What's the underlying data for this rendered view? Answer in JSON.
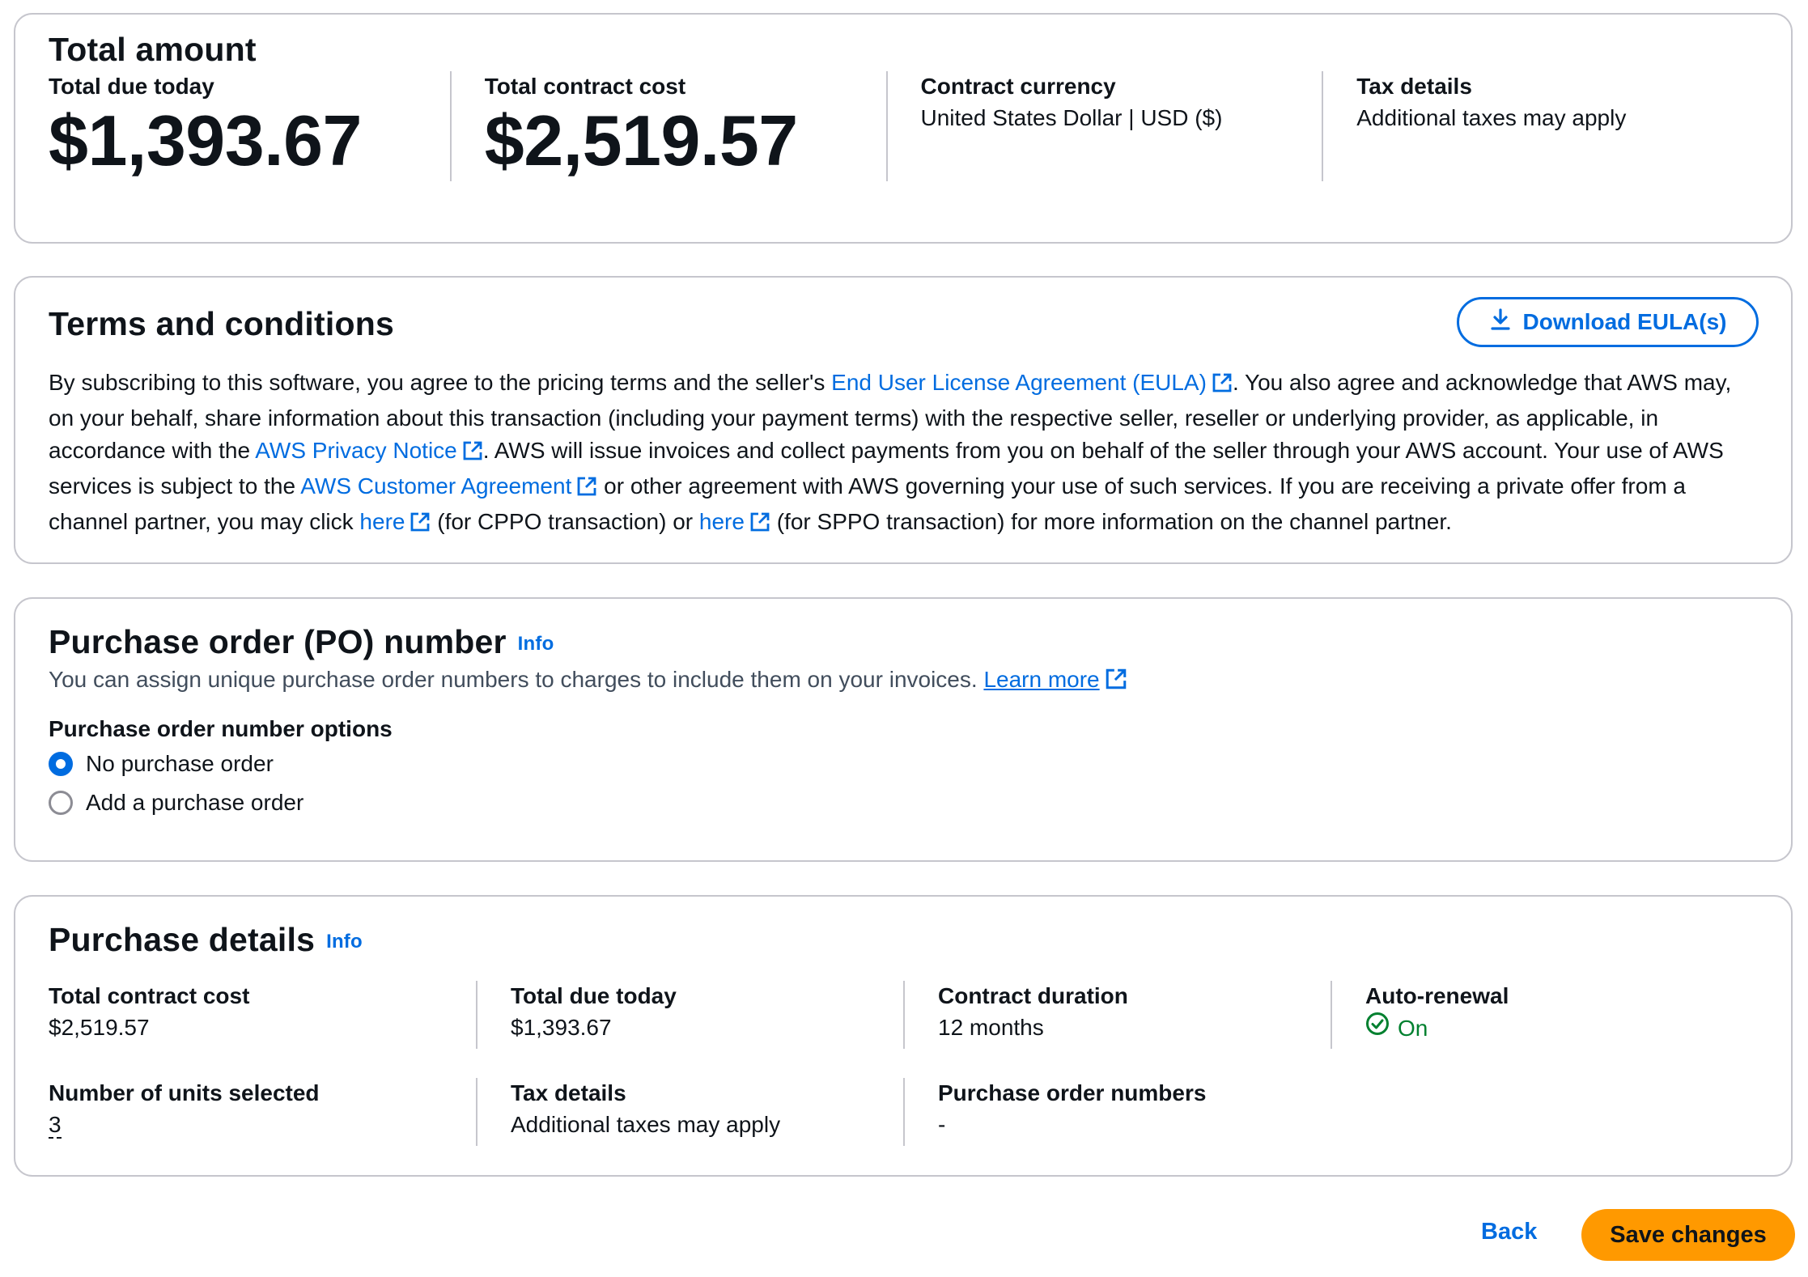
{
  "total_amount": {
    "title": "Total amount",
    "due_today_label": "Total due today",
    "due_today_value": "$1,393.67",
    "contract_cost_label": "Total contract cost",
    "contract_cost_value": "$2,519.57",
    "currency_label": "Contract currency",
    "currency_value": "United States Dollar | USD ($)",
    "tax_label": "Tax details",
    "tax_value": "Additional taxes may apply"
  },
  "terms": {
    "title": "Terms and conditions",
    "download_label": "Download EULA(s)",
    "text_1": "By subscribing to this software, you agree to the pricing terms and the seller's ",
    "link_eula": "End User License Agreement (EULA)",
    "text_2": ". You also agree and acknowledge that AWS may, on your behalf, share information about this transaction (including your payment terms) with the respective seller, reseller or underlying provider, as applicable, in accordance with the ",
    "link_privacy": "AWS Privacy Notice",
    "text_3": ". AWS will issue invoices and collect payments from you on behalf of the seller through your AWS account. Your use of AWS services is subject to the ",
    "link_customer": "AWS Customer Agreement",
    "text_4": " or other agreement with AWS governing your use of such services. If you are receiving a private offer from a channel partner, you may click ",
    "link_here_1": "here",
    "text_5": " (for CPPO transaction) or ",
    "link_here_2": "here",
    "text_6": " (for SPPO transaction) for more information on the channel partner."
  },
  "po": {
    "title": "Purchase order (PO) number",
    "info_label": "Info",
    "description": "You can assign unique purchase order numbers to charges to include them on your invoices. ",
    "learn_more": "Learn more",
    "options_label": "Purchase order number options",
    "options": [
      {
        "label": "No purchase order",
        "selected": true
      },
      {
        "label": "Add a purchase order",
        "selected": false
      }
    ]
  },
  "details": {
    "title": "Purchase details",
    "info_label": "Info",
    "contract_cost_label": "Total contract cost",
    "contract_cost_value": "$2,519.57",
    "due_today_label": "Total due today",
    "due_today_value": "$1,393.67",
    "duration_label": "Contract duration",
    "duration_value": "12 months",
    "auto_renewal_label": "Auto-renewal",
    "auto_renewal_value": "On",
    "units_label": "Number of units selected",
    "units_value": "3",
    "tax_label": "Tax details",
    "tax_value": "Additional taxes may apply",
    "po_numbers_label": "Purchase order numbers",
    "po_numbers_value": "-"
  },
  "footer": {
    "back_label": "Back",
    "save_label": "Save changes"
  },
  "colors": {
    "link": "#006ce0",
    "primary_button": "#ff9900",
    "success": "#00802f",
    "border": "#c6c6cd"
  },
  "icons": [
    "download-icon",
    "external-link-icon",
    "check-circle-icon"
  ]
}
